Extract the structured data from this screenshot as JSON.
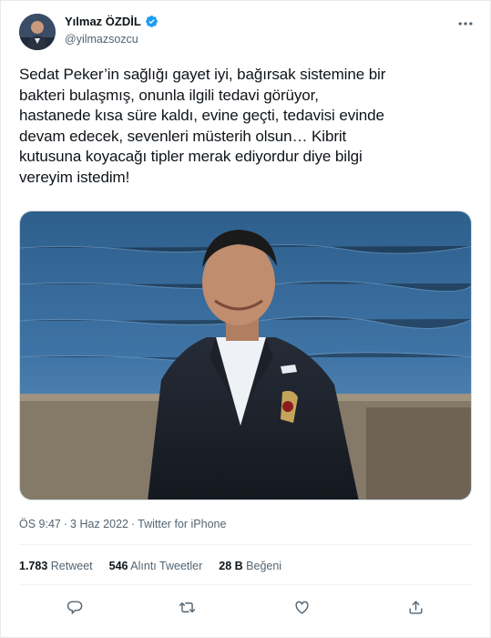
{
  "author": {
    "name": "Yılmaz ÖZDİL",
    "handle": "@yilmazsozcu",
    "verified": true
  },
  "tweet": {
    "text": "Sedat Peker’in sağlığı gayet iyi, bağırsak sistemine bir\nbakteri bulaşmış, onunla ilgili tedavi görüyor,\nhastanede kısa süre kaldı, evine geçti, tedavisi evinde\ndevam edecek, sevenleri müsterih olsun… Kibrit\nkutusuna koyacağı tipler merak ediyordur diye bilgi\nvereyim istedim!"
  },
  "meta": {
    "time": "ÖS 9:47",
    "sep1": "·",
    "date": "3 Haz 2022",
    "sep2": "·",
    "source": "Twitter for iPhone"
  },
  "stats": [
    {
      "count": "1.783",
      "label": "Retweet"
    },
    {
      "count": "546",
      "label": "Alıntı Tweetler"
    },
    {
      "count": "28 B",
      "label": "Beğeni"
    }
  ],
  "colors": {
    "verified": "#1d9bf0",
    "text": "#0f1419",
    "secondary": "#536471",
    "border": "#eff3f4"
  },
  "icons": {
    "more": "more-icon",
    "reply": "reply-icon",
    "retweet": "retweet-icon",
    "like": "like-icon",
    "share": "share-icon"
  }
}
